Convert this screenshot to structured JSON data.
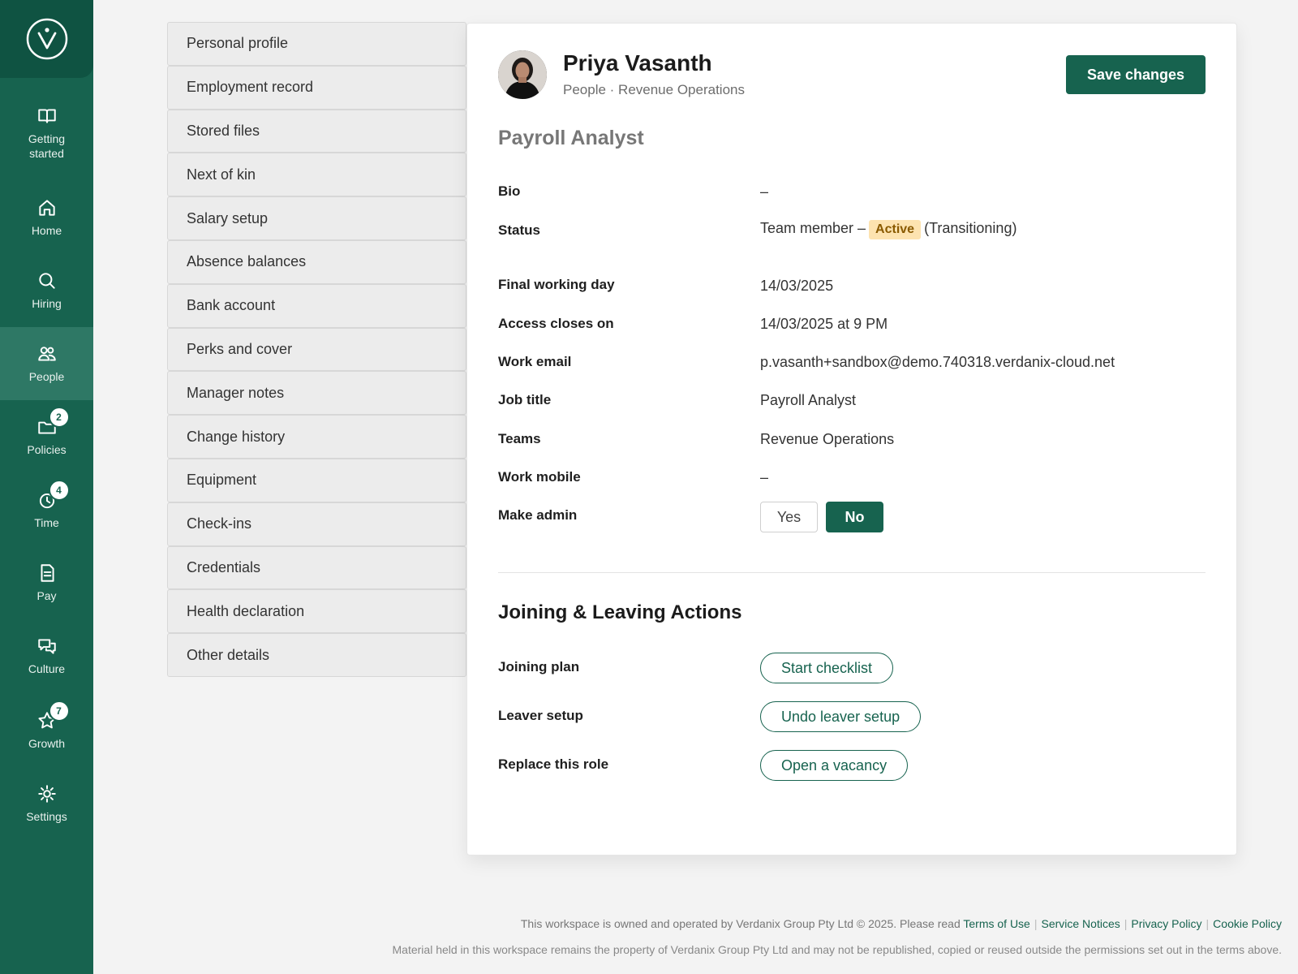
{
  "nav": {
    "items": [
      {
        "label": "Getting\nstarted",
        "icon": "book-icon",
        "badge": ""
      },
      {
        "label": "Home",
        "icon": "home-icon",
        "badge": ""
      },
      {
        "label": "Hiring",
        "icon": "search-icon",
        "badge": ""
      },
      {
        "label": "People",
        "icon": "people-icon",
        "badge": "",
        "active": true
      },
      {
        "label": "Policies",
        "icon": "folder-icon",
        "badge": "2"
      },
      {
        "label": "Time",
        "icon": "clock-icon",
        "badge": "4"
      },
      {
        "label": "Pay",
        "icon": "document-icon",
        "badge": ""
      },
      {
        "label": "Culture",
        "icon": "chat-icon",
        "badge": ""
      },
      {
        "label": "Growth",
        "icon": "star-icon",
        "badge": "7"
      },
      {
        "label": "Settings",
        "icon": "gear-icon",
        "badge": ""
      }
    ]
  },
  "menu": {
    "items": [
      "Personal profile",
      "Employment record",
      "Stored files",
      "Next of kin",
      "Salary setup",
      "Absence balances",
      "Bank account",
      "Perks and cover",
      "Manager notes",
      "Change history",
      "Equipment",
      "Check-ins",
      "Credentials",
      "Health declaration",
      "Other details"
    ]
  },
  "profile": {
    "name": "Priya Vasanth",
    "subtitle": "People · Revenue Operations",
    "save_label": "Save changes",
    "role_title": "Payroll Analyst",
    "bio_label": "Bio",
    "bio_value": "–",
    "status_label": "Status",
    "status_prefix": "Team member –",
    "status_badge": "Active",
    "status_suffix": "(Transitioning)",
    "final_day_label": "Final working day",
    "final_day_value": "14/03/2025",
    "access_label": "Access closes on",
    "access_value": "14/03/2025 at 9 PM",
    "email_label": "Work email",
    "email_value": "p.vasanth+sandbox@demo.740318.verdanix-cloud.net",
    "job_label": "Job title",
    "job_value": "Payroll Analyst",
    "teams_label": "Teams",
    "teams_value": "Revenue Operations",
    "mobile_label": "Work mobile",
    "mobile_value": "–",
    "admin_label": "Make admin",
    "admin_yes": "Yes",
    "admin_no": "No",
    "admin_selected": "No"
  },
  "actions": {
    "title": "Joining & Leaving Actions",
    "joining_label": "Joining plan",
    "joining_button": "Start checklist",
    "leaver_label": "Leaver setup",
    "leaver_button": "Undo leaver setup",
    "replace_label": "Replace this role",
    "replace_button": "Open a vacancy"
  },
  "footer": {
    "line1": "This workspace is owned and operated by Verdanix Group Pty Ltd © 2025. Please read",
    "terms": "Terms of Use",
    "notices": "Service Notices",
    "privacy": "Privacy Policy",
    "cookies": "Cookie Policy",
    "line2": "Material held in this workspace remains the property of Verdanix Group Pty Ltd and may not be republished, copied or reused outside the permissions set out in the terms above."
  },
  "colors": {
    "brand": "#17634f",
    "rail_active": "#2e7865",
    "badge_active_bg": "#fde3b0"
  }
}
